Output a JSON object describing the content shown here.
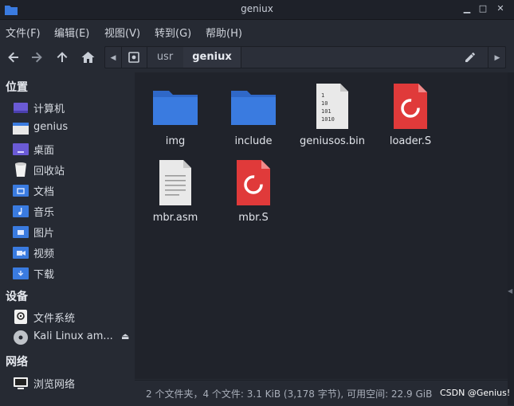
{
  "window": {
    "title": "geniux"
  },
  "menu": [
    "文件(F)",
    "编辑(E)",
    "视图(V)",
    "转到(G)",
    "帮助(H)"
  ],
  "path": {
    "segments": [
      "usr",
      "geniux"
    ]
  },
  "sidebar": {
    "places_header": "位置",
    "places": [
      {
        "label": "计算机",
        "icon": "computer-icon"
      },
      {
        "label": "genius",
        "icon": "home-folder-icon"
      },
      {
        "label": "桌面",
        "icon": "desktop-folder-icon"
      },
      {
        "label": "回收站",
        "icon": "trash-icon"
      },
      {
        "label": "文档",
        "icon": "documents-folder-icon"
      },
      {
        "label": "音乐",
        "icon": "music-folder-icon"
      },
      {
        "label": "图片",
        "icon": "pictures-folder-icon"
      },
      {
        "label": "视频",
        "icon": "videos-folder-icon"
      },
      {
        "label": "下载",
        "icon": "downloads-folder-icon"
      }
    ],
    "devices_header": "设备",
    "devices": [
      {
        "label": "文件系统",
        "icon": "filesystem-icon"
      },
      {
        "label": "Kali Linux am...",
        "icon": "disc-icon",
        "eject": "⏏"
      }
    ],
    "network_header": "网络",
    "network": [
      {
        "label": "浏览网络",
        "icon": "network-icon"
      }
    ]
  },
  "files": [
    {
      "name": "img",
      "icon": "folder-icon"
    },
    {
      "name": "include",
      "icon": "folder-icon"
    },
    {
      "name": "geniusos.bin",
      "icon": "binary-file-icon",
      "bin_lines": [
        "1",
        "10",
        "101",
        "1010"
      ]
    },
    {
      "name": "loader.S",
      "icon": "debian-source-icon"
    },
    {
      "name": "mbr.asm",
      "icon": "text-file-icon"
    },
    {
      "name": "mbr.S",
      "icon": "debian-source-icon"
    }
  ],
  "status": {
    "text": "2 个文件夹，4 个文件: 3.1 KiB (3,178 字节), 可用空间: 22.9 GiB"
  },
  "watermark": "CSDN @Genius!",
  "colors": {
    "folder_blue": "#3a7be0",
    "source_red": "#e03a3a"
  }
}
